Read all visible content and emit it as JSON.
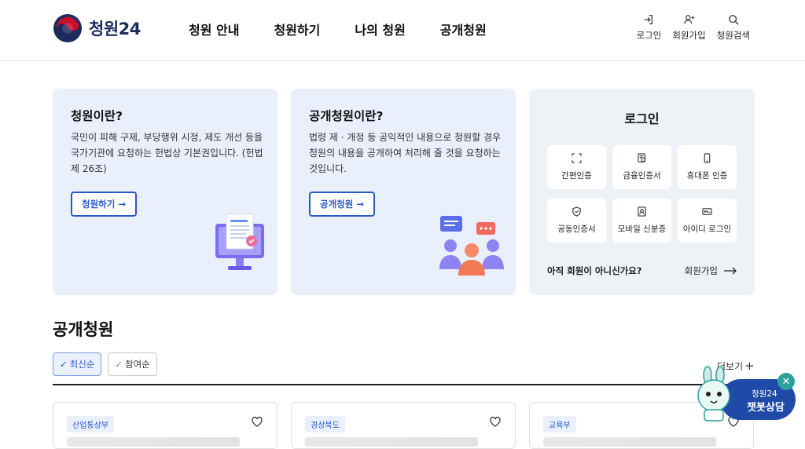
{
  "header": {
    "logo_text": "청원24",
    "nav": [
      "청원 안내",
      "청원하기",
      "나의 청원",
      "공개청원"
    ],
    "util": [
      {
        "label": "로그인",
        "icon": "login-icon"
      },
      {
        "label": "회원가입",
        "icon": "user-plus-icon"
      },
      {
        "label": "청원검색",
        "icon": "search-icon"
      }
    ]
  },
  "cards": {
    "petition": {
      "title": "청원이란?",
      "desc": "국민이 피해 구제, 부당행위 시정, 제도 개선 등을 국가기관에 요청하는 헌법상 기본권입니다. (헌법 제 26조)",
      "button": "청원하기 →"
    },
    "public": {
      "title": "공개청원이란?",
      "desc": "법령 제 · 개정 등 공익적인 내용으로 청원할 경우 청원의 내용을 공개하여 처리해 줄 것을 요청하는 것입니다.",
      "button": "공개청원 →"
    },
    "login": {
      "title": "로그인",
      "methods": [
        {
          "label": "간편인증",
          "icon": "scan-icon"
        },
        {
          "label": "금융인증서",
          "icon": "certificate-icon"
        },
        {
          "label": "휴대폰 인증",
          "icon": "phone-icon"
        },
        {
          "label": "공동인증서",
          "icon": "shield-icon"
        },
        {
          "label": "모바일 신분증",
          "icon": "id-card-icon"
        },
        {
          "label": "아이디 로그인",
          "icon": "password-icon"
        }
      ],
      "join_question": "아직 회원이 아니신가요?",
      "join_link": "회원가입"
    }
  },
  "section": {
    "title": "공개청원",
    "sort": [
      "최신순",
      "참여순"
    ],
    "more": "더보기",
    "tags": [
      "산업통상부",
      "경상북도",
      "교육부"
    ]
  },
  "chatbot": {
    "line1": "청원24",
    "line2": "챗봇상담"
  },
  "colors": {
    "accent": "#2a58c7",
    "card_bg": "#e9f0fb",
    "login_bg": "#eef1f6",
    "chat_bg": "#1f4aa8"
  }
}
